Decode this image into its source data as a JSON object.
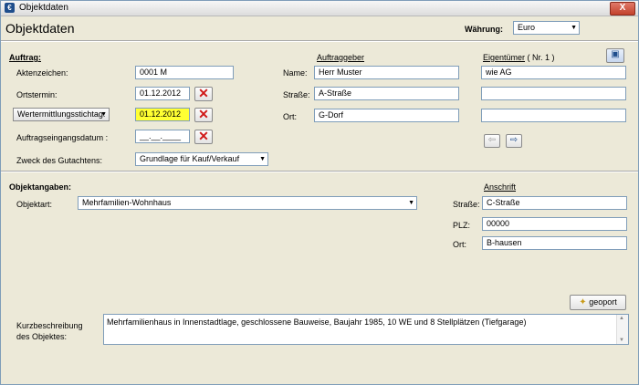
{
  "window": {
    "title": "Objektdaten",
    "close_glyph": "X"
  },
  "page": {
    "title": "Objektdaten"
  },
  "currency": {
    "label": "Währung:",
    "value": "Euro"
  },
  "auftrag": {
    "heading": "Auftrag:",
    "aktenzeichen_label": "Aktenzeichen:",
    "aktenzeichen_value": "0001 M",
    "ortstermin_label": "Ortstermin:",
    "ortstermin_value": "01.12.2012",
    "stichtag_dropdown": "Wertermittlungsstichtag:",
    "stichtag_value": "01.12.2012",
    "eingang_label": "Auftragseingangsdatum :",
    "eingang_value": "__.__.____",
    "zweck_label": "Zweck des Gutachtens:",
    "zweck_value": "Grundlage für Kauf/Verkauf"
  },
  "auftraggeber": {
    "heading": "Auftraggeber",
    "name_label": "Name:",
    "name_value": "Herr Muster",
    "strasse_label": "Straße:",
    "strasse_value": "A-Straße",
    "ort_label": "Ort:",
    "ort_value": "G-Dorf"
  },
  "eigentuemer": {
    "heading": "Eigentümer",
    "number": "( Nr. 1 )",
    "line1": "wie AG",
    "line2": "",
    "line3": ""
  },
  "objektangaben": {
    "heading": "Objektangaben:",
    "objektart_label": "Objektart:",
    "objektart_value": "Mehrfamilien-Wohnhaus"
  },
  "anschrift": {
    "heading": "Anschrift",
    "strasse_label": "Straße:",
    "strasse_value": "C-Straße",
    "plz_label": "PLZ:",
    "plz_value": "00000",
    "ort_label": "Ort:",
    "ort_value": "B-hausen"
  },
  "geoport": {
    "label": "geoport"
  },
  "kurzbeschreibung": {
    "label_line1": "Kurzbeschreibung",
    "label_line2": "des Objektes:",
    "text": "Mehrfamilienhaus in Innenstadtlage, geschlossene Bauweise, Baujahr 1985, 10 WE und 8 Stellplätzen (Tiefgarage)"
  },
  "colors": {
    "highlight": "#ffff33",
    "delete": "#d01818",
    "accent": "#1f4e8c"
  }
}
